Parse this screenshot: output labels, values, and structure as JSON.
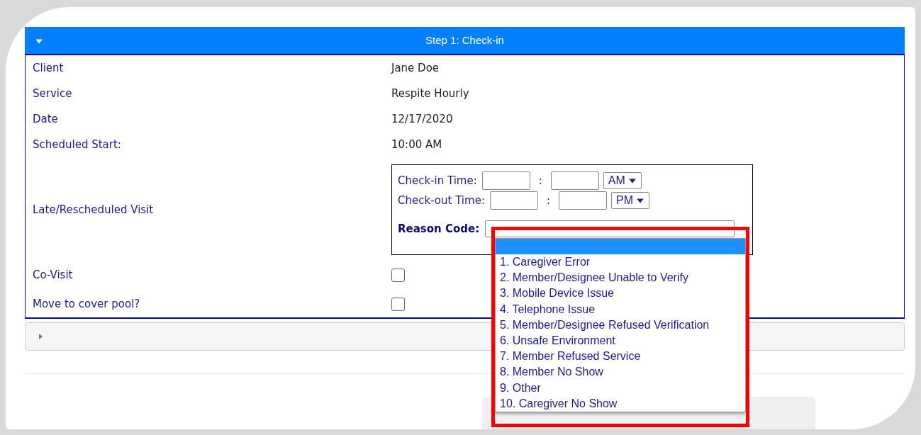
{
  "header": {
    "title": "Step 1: Check-in",
    "expanded": true
  },
  "fields": [
    {
      "label": "Client",
      "value": "Jane Doe"
    },
    {
      "label": "Service",
      "value": "Respite Hourly"
    },
    {
      "label": "Date",
      "value": "12/17/2020"
    },
    {
      "label": "Scheduled Start:",
      "value": "10:00 AM"
    }
  ],
  "late_visit": {
    "label": "Late/Rescheduled Visit",
    "times": [
      {
        "label": "Check-in Time:",
        "separator": ":",
        "period": "AM"
      },
      {
        "label": "Check-out Time:",
        "separator": ":",
        "period": "PM"
      }
    ],
    "reason_label": "Reason Code:"
  },
  "checkboxes": [
    {
      "label": "Co-Visit",
      "checked": false
    },
    {
      "label": "Move to cover pool?",
      "checked": false
    }
  ],
  "collapsed_section": {
    "expanded": false
  },
  "reason_dropdown": {
    "blank_highlighted": true,
    "options": [
      {
        "label": "1. Caregiver Error",
        "selected": false
      },
      {
        "label": "2. Member/Designee Unable to Verify",
        "selected": false
      },
      {
        "label": "3. Mobile Device Issue",
        "selected": false
      },
      {
        "label": "4. Telephone Issue",
        "selected": false
      },
      {
        "label": "5. Member/Designee Refused Verification",
        "selected": false
      },
      {
        "label": "6. Unsafe Environment",
        "selected": false
      },
      {
        "label": "7. Member Refused Service",
        "selected": false
      },
      {
        "label": "8. Member No Show",
        "selected": false
      },
      {
        "label": "9. Other",
        "selected": false
      },
      {
        "label": "10. Caregiver No Show",
        "selected": false
      }
    ]
  }
}
